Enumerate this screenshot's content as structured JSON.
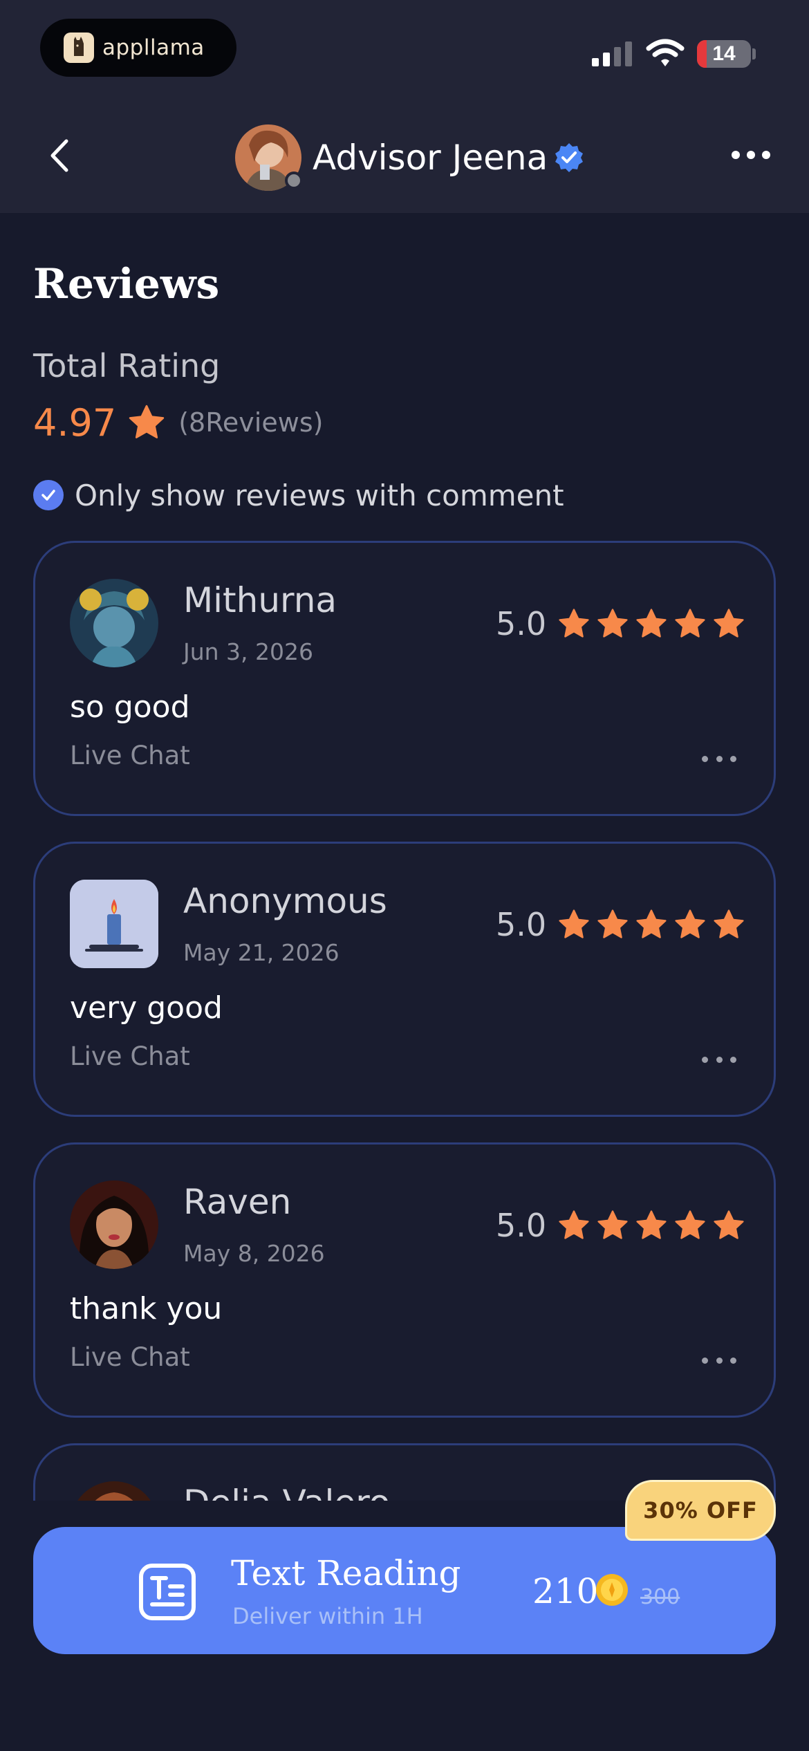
{
  "status_bar": {
    "app_pill_label": "appllama",
    "battery": "14"
  },
  "header": {
    "advisor_name": "Advisor Jeena",
    "back_icon": "chevron-left-icon",
    "more_icon": "more-horizontal-icon",
    "verified_icon": "verified-badge-icon"
  },
  "reviews": {
    "title": "Reviews",
    "total_label": "Total Rating",
    "average": "4.97",
    "count_text": "(8Reviews)",
    "filter_label": "Only show reviews with comment",
    "filter_checked": true,
    "items": [
      {
        "name": "Mithurna",
        "date": "Jun 3, 2026",
        "score": "5.0",
        "stars": 5,
        "comment": "so good",
        "channel": "Live Chat"
      },
      {
        "name": "Anonymous",
        "date": "May 21, 2026",
        "score": "5.0",
        "stars": 5,
        "comment": "very good",
        "channel": "Live Chat"
      },
      {
        "name": "Raven",
        "date": "May 8, 2026",
        "score": "5.0",
        "stars": 5,
        "comment": "thank you",
        "channel": "Live Chat"
      },
      {
        "name": "Delia Valero"
      }
    ]
  },
  "cta": {
    "badge": "30% OFF",
    "title": "Text Reading",
    "subtitle": "Deliver within 1H",
    "price": "210",
    "old_price": "300",
    "icon": "text-reading-icon"
  },
  "colors": {
    "background": "#171a2c",
    "header": "#222436",
    "accent_orange": "#f7894a",
    "accent_blue": "#5b82f6",
    "card_border": "#2c3d7a",
    "badge": "#f9d37c"
  }
}
